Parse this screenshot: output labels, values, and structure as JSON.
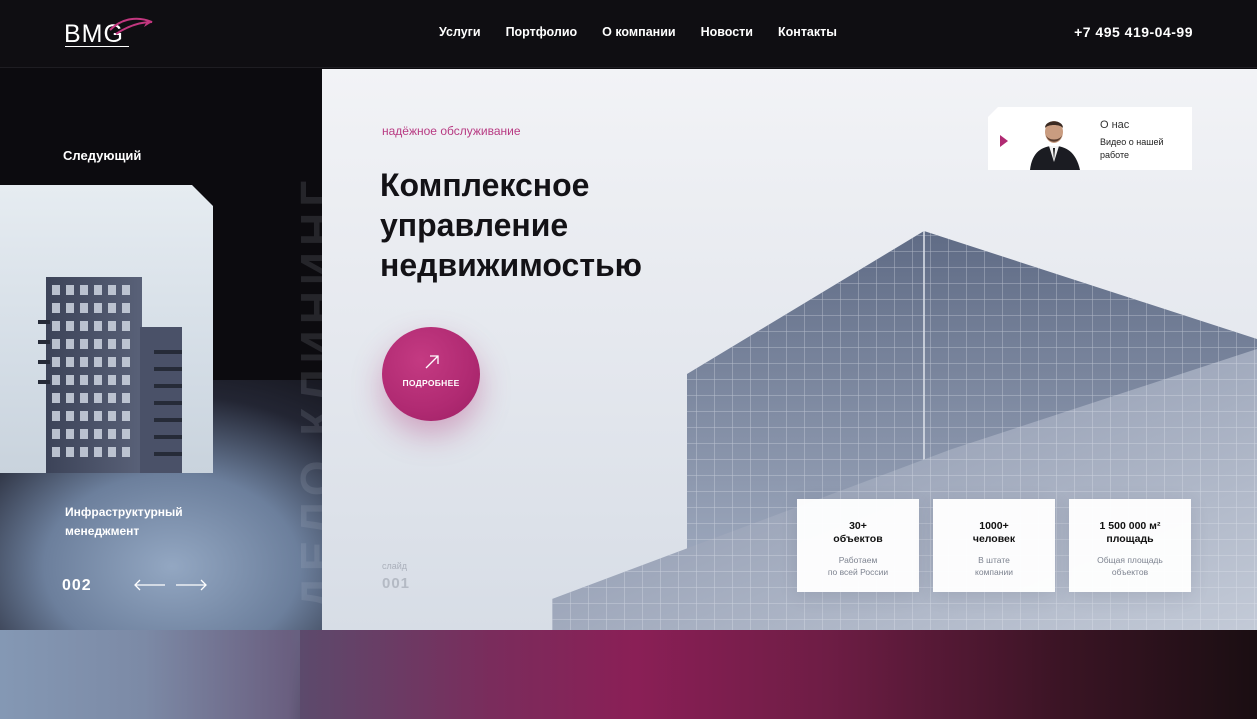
{
  "header": {
    "logo_text": "BMG",
    "nav": [
      "Услуги",
      "Портфолио",
      "О компании",
      "Новости",
      "Контакты"
    ],
    "phone": "+7 495 419-04-99"
  },
  "sidebar": {
    "next_label": "Следующий",
    "next_title": "Инфраструктурный менеджмент",
    "next_slide_number": "002",
    "vertical_word": "ДЕЛО КЛИНИНГ"
  },
  "hero": {
    "tagline": "надёжное обслуживание",
    "title_lines": [
      "Комплексное",
      "управление",
      "недвижимостью"
    ],
    "more_button": "ПОДРОБНЕЕ",
    "slide_label": "слайд",
    "slide_number": "001"
  },
  "about": {
    "title": "О нас",
    "subtitle": "Видео о нашей работе"
  },
  "stats": [
    {
      "value": "30+\nобъектов",
      "caption": "Работаем\nпо всей России"
    },
    {
      "value": "1000+\nчеловек",
      "caption": "В штате\nкомпании"
    },
    {
      "value": "1 500 000 м²\nплощадь",
      "caption": "Общая площадь\nобъектов"
    }
  ],
  "colors": {
    "accent": "#b02a72",
    "dark": "#0f0e12"
  }
}
